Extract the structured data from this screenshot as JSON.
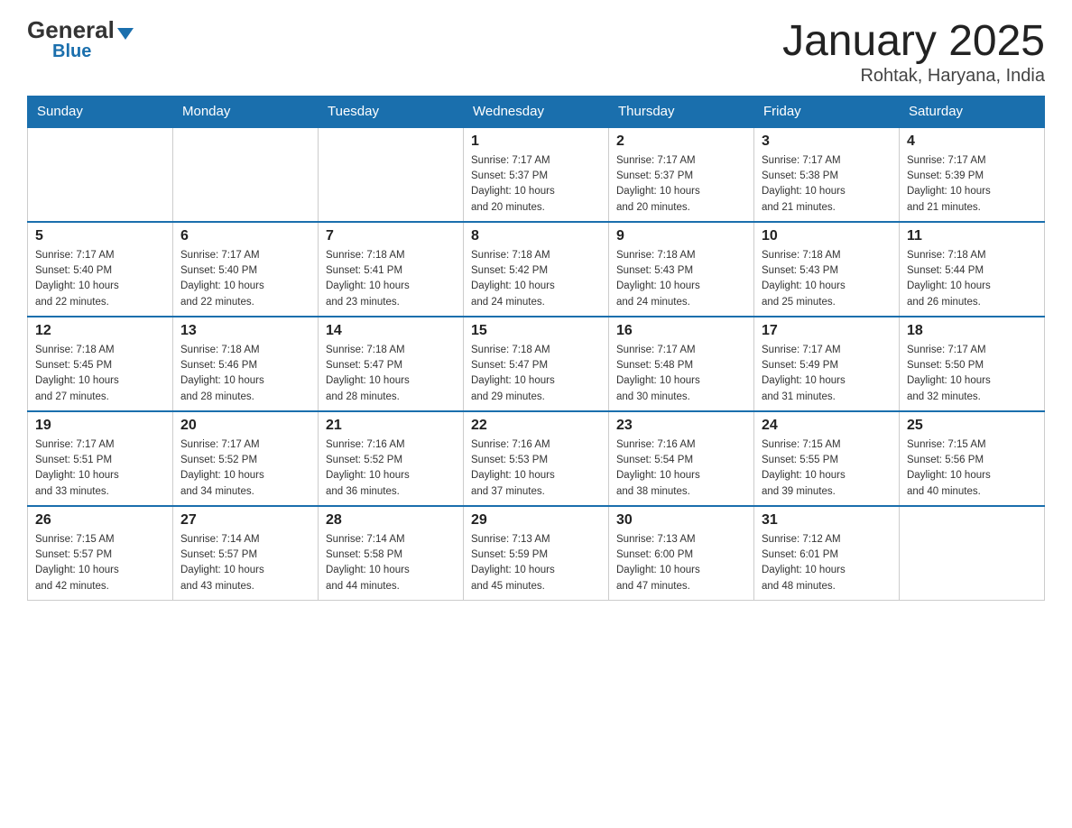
{
  "logo": {
    "general": "General",
    "triangle": "▶",
    "blue": "Blue"
  },
  "title": "January 2025",
  "subtitle": "Rohtak, Haryana, India",
  "headers": [
    "Sunday",
    "Monday",
    "Tuesday",
    "Wednesday",
    "Thursday",
    "Friday",
    "Saturday"
  ],
  "weeks": [
    [
      {
        "day": "",
        "info": ""
      },
      {
        "day": "",
        "info": ""
      },
      {
        "day": "",
        "info": ""
      },
      {
        "day": "1",
        "info": "Sunrise: 7:17 AM\nSunset: 5:37 PM\nDaylight: 10 hours\nand 20 minutes."
      },
      {
        "day": "2",
        "info": "Sunrise: 7:17 AM\nSunset: 5:37 PM\nDaylight: 10 hours\nand 20 minutes."
      },
      {
        "day": "3",
        "info": "Sunrise: 7:17 AM\nSunset: 5:38 PM\nDaylight: 10 hours\nand 21 minutes."
      },
      {
        "day": "4",
        "info": "Sunrise: 7:17 AM\nSunset: 5:39 PM\nDaylight: 10 hours\nand 21 minutes."
      }
    ],
    [
      {
        "day": "5",
        "info": "Sunrise: 7:17 AM\nSunset: 5:40 PM\nDaylight: 10 hours\nand 22 minutes."
      },
      {
        "day": "6",
        "info": "Sunrise: 7:17 AM\nSunset: 5:40 PM\nDaylight: 10 hours\nand 22 minutes."
      },
      {
        "day": "7",
        "info": "Sunrise: 7:18 AM\nSunset: 5:41 PM\nDaylight: 10 hours\nand 23 minutes."
      },
      {
        "day": "8",
        "info": "Sunrise: 7:18 AM\nSunset: 5:42 PM\nDaylight: 10 hours\nand 24 minutes."
      },
      {
        "day": "9",
        "info": "Sunrise: 7:18 AM\nSunset: 5:43 PM\nDaylight: 10 hours\nand 24 minutes."
      },
      {
        "day": "10",
        "info": "Sunrise: 7:18 AM\nSunset: 5:43 PM\nDaylight: 10 hours\nand 25 minutes."
      },
      {
        "day": "11",
        "info": "Sunrise: 7:18 AM\nSunset: 5:44 PM\nDaylight: 10 hours\nand 26 minutes."
      }
    ],
    [
      {
        "day": "12",
        "info": "Sunrise: 7:18 AM\nSunset: 5:45 PM\nDaylight: 10 hours\nand 27 minutes."
      },
      {
        "day": "13",
        "info": "Sunrise: 7:18 AM\nSunset: 5:46 PM\nDaylight: 10 hours\nand 28 minutes."
      },
      {
        "day": "14",
        "info": "Sunrise: 7:18 AM\nSunset: 5:47 PM\nDaylight: 10 hours\nand 28 minutes."
      },
      {
        "day": "15",
        "info": "Sunrise: 7:18 AM\nSunset: 5:47 PM\nDaylight: 10 hours\nand 29 minutes."
      },
      {
        "day": "16",
        "info": "Sunrise: 7:17 AM\nSunset: 5:48 PM\nDaylight: 10 hours\nand 30 minutes."
      },
      {
        "day": "17",
        "info": "Sunrise: 7:17 AM\nSunset: 5:49 PM\nDaylight: 10 hours\nand 31 minutes."
      },
      {
        "day": "18",
        "info": "Sunrise: 7:17 AM\nSunset: 5:50 PM\nDaylight: 10 hours\nand 32 minutes."
      }
    ],
    [
      {
        "day": "19",
        "info": "Sunrise: 7:17 AM\nSunset: 5:51 PM\nDaylight: 10 hours\nand 33 minutes."
      },
      {
        "day": "20",
        "info": "Sunrise: 7:17 AM\nSunset: 5:52 PM\nDaylight: 10 hours\nand 34 minutes."
      },
      {
        "day": "21",
        "info": "Sunrise: 7:16 AM\nSunset: 5:52 PM\nDaylight: 10 hours\nand 36 minutes."
      },
      {
        "day": "22",
        "info": "Sunrise: 7:16 AM\nSunset: 5:53 PM\nDaylight: 10 hours\nand 37 minutes."
      },
      {
        "day": "23",
        "info": "Sunrise: 7:16 AM\nSunset: 5:54 PM\nDaylight: 10 hours\nand 38 minutes."
      },
      {
        "day": "24",
        "info": "Sunrise: 7:15 AM\nSunset: 5:55 PM\nDaylight: 10 hours\nand 39 minutes."
      },
      {
        "day": "25",
        "info": "Sunrise: 7:15 AM\nSunset: 5:56 PM\nDaylight: 10 hours\nand 40 minutes."
      }
    ],
    [
      {
        "day": "26",
        "info": "Sunrise: 7:15 AM\nSunset: 5:57 PM\nDaylight: 10 hours\nand 42 minutes."
      },
      {
        "day": "27",
        "info": "Sunrise: 7:14 AM\nSunset: 5:57 PM\nDaylight: 10 hours\nand 43 minutes."
      },
      {
        "day": "28",
        "info": "Sunrise: 7:14 AM\nSunset: 5:58 PM\nDaylight: 10 hours\nand 44 minutes."
      },
      {
        "day": "29",
        "info": "Sunrise: 7:13 AM\nSunset: 5:59 PM\nDaylight: 10 hours\nand 45 minutes."
      },
      {
        "day": "30",
        "info": "Sunrise: 7:13 AM\nSunset: 6:00 PM\nDaylight: 10 hours\nand 47 minutes."
      },
      {
        "day": "31",
        "info": "Sunrise: 7:12 AM\nSunset: 6:01 PM\nDaylight: 10 hours\nand 48 minutes."
      },
      {
        "day": "",
        "info": ""
      }
    ]
  ]
}
